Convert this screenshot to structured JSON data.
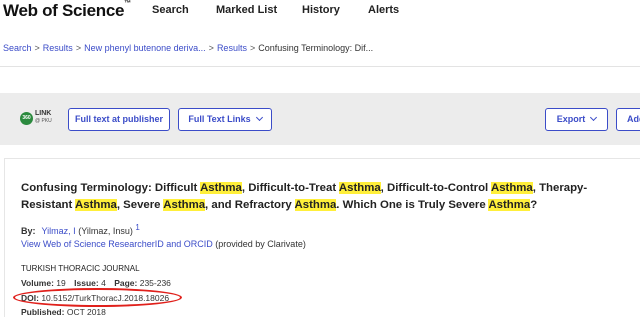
{
  "header": {
    "brand": "Web of Science",
    "brand_tm": "™",
    "nav": [
      "Search",
      "Marked List",
      "History",
      "Alerts"
    ]
  },
  "breadcrumb": [
    "Search",
    "Results",
    "New phenyl butenone deriva...",
    "Results",
    "Confusing Terminology: Dif..."
  ],
  "toolbar": {
    "badge_circle": "360",
    "badge_line1": "LINK",
    "badge_line2": "@ PKU",
    "full_text_publisher": "Full text at publisher",
    "full_text_links": "Full Text Links",
    "export": "Export",
    "add": "Add"
  },
  "record": {
    "title_parts": [
      {
        "t": "Confusing Terminology: Difficult ",
        "hl": false
      },
      {
        "t": "Asthma",
        "hl": true
      },
      {
        "t": ", Difficult-to-Treat ",
        "hl": false
      },
      {
        "t": "Asthma",
        "hl": true
      },
      {
        "t": ", Difficult-to-Control ",
        "hl": false
      },
      {
        "t": "Asthma",
        "hl": true
      },
      {
        "t": ", Therapy-Resistant ",
        "hl": false
      },
      {
        "t": "Asthma",
        "hl": true
      },
      {
        "t": ", Severe ",
        "hl": false
      },
      {
        "t": "Asthma",
        "hl": true
      },
      {
        "t": ", and Refractory ",
        "hl": false
      },
      {
        "t": "Asthma",
        "hl": true
      },
      {
        "t": ". Which One is Truly Severe ",
        "hl": false
      },
      {
        "t": "Asthma",
        "hl": true
      },
      {
        "t": "?",
        "hl": false
      }
    ],
    "by_label": "By:",
    "author": "Yilmaz, I",
    "author_full": "(Yilmaz, Insu)",
    "author_sup": "1",
    "rid_link": "View Web of Science ResearcherID and ORCID",
    "rid_suffix": "(provided by Clarivate)",
    "journal": "TURKISH THORACIC JOURNAL",
    "volume_label": "Volume:",
    "volume": "19",
    "issue_label": "Issue:",
    "issue": "4",
    "page_label": "Page:",
    "pages": "235-236",
    "doi_label": "DOI:",
    "doi": "10.5152/TurkThoracJ.2018.18026",
    "published_label": "Published:",
    "published": "OCT 2018"
  },
  "colors": {
    "link": "#3b4cc8",
    "highlight": "#ffef3a",
    "annotation_oval": "#e0201b"
  }
}
